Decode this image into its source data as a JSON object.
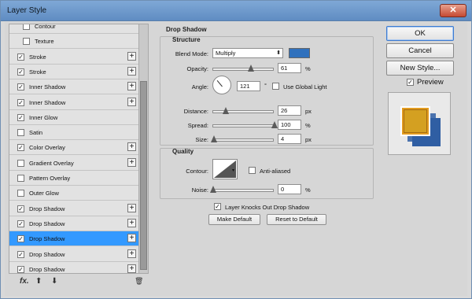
{
  "window": {
    "title": "Layer Style",
    "close_glyph": "✕"
  },
  "styles_list": {
    "items": [
      {
        "label": "Contour",
        "checked": false,
        "plus": false,
        "indent": true
      },
      {
        "label": "Texture",
        "checked": false,
        "plus": false,
        "indent": true
      },
      {
        "label": "Stroke",
        "checked": true,
        "plus": true
      },
      {
        "label": "Stroke",
        "checked": true,
        "plus": true
      },
      {
        "label": "Inner Shadow",
        "checked": true,
        "plus": true
      },
      {
        "label": "Inner Shadow",
        "checked": true,
        "plus": true
      },
      {
        "label": "Inner Glow",
        "checked": true,
        "plus": false
      },
      {
        "label": "Satin",
        "checked": false,
        "plus": false
      },
      {
        "label": "Color Overlay",
        "checked": true,
        "plus": true
      },
      {
        "label": "Gradient Overlay",
        "checked": false,
        "plus": true
      },
      {
        "label": "Pattern Overlay",
        "checked": false,
        "plus": false
      },
      {
        "label": "Outer Glow",
        "checked": false,
        "plus": false
      },
      {
        "label": "Drop Shadow",
        "checked": true,
        "plus": true
      },
      {
        "label": "Drop Shadow",
        "checked": true,
        "plus": true
      },
      {
        "label": "Drop Shadow",
        "checked": true,
        "plus": true,
        "selected": true
      },
      {
        "label": "Drop Shadow",
        "checked": true,
        "plus": true
      },
      {
        "label": "Drop Shadow",
        "checked": true,
        "plus": true
      }
    ],
    "footer": {
      "fx": "fx.",
      "up": "⬆",
      "down": "⬇",
      "trash": "🗑"
    }
  },
  "drop_shadow": {
    "heading": "Drop Shadow",
    "structure_title": "Structure",
    "blend_mode_label": "Blend Mode:",
    "blend_mode_value": "Multiply",
    "shadow_color": "#3071bd",
    "opacity_label": "Opacity:",
    "opacity_value": "61",
    "opacity_unit": "%",
    "angle_label": "Angle:",
    "angle_value": "121",
    "angle_unit": "°",
    "global_light_label": "Use Global Light",
    "distance_label": "Distance:",
    "distance_value": "26",
    "distance_unit": "px",
    "spread_label": "Spread:",
    "spread_value": "100",
    "spread_unit": "%",
    "size_label": "Size:",
    "size_value": "4",
    "size_unit": "px",
    "quality_title": "Quality",
    "contour_label": "Contour:",
    "antialiased_label": "Anti-aliased",
    "noise_label": "Noise:",
    "noise_value": "0",
    "noise_unit": "%",
    "knockout_label": "Layer Knocks Out Drop Shadow",
    "make_default": "Make Default",
    "reset_default": "Reset to Default"
  },
  "actions": {
    "ok": "OK",
    "cancel": "Cancel",
    "new_style": "New Style...",
    "preview_label": "Preview"
  },
  "preview": {
    "front_color": "#e39c1f",
    "inner_color": "#d4a021",
    "shadow_color": "#2f5ea3"
  }
}
